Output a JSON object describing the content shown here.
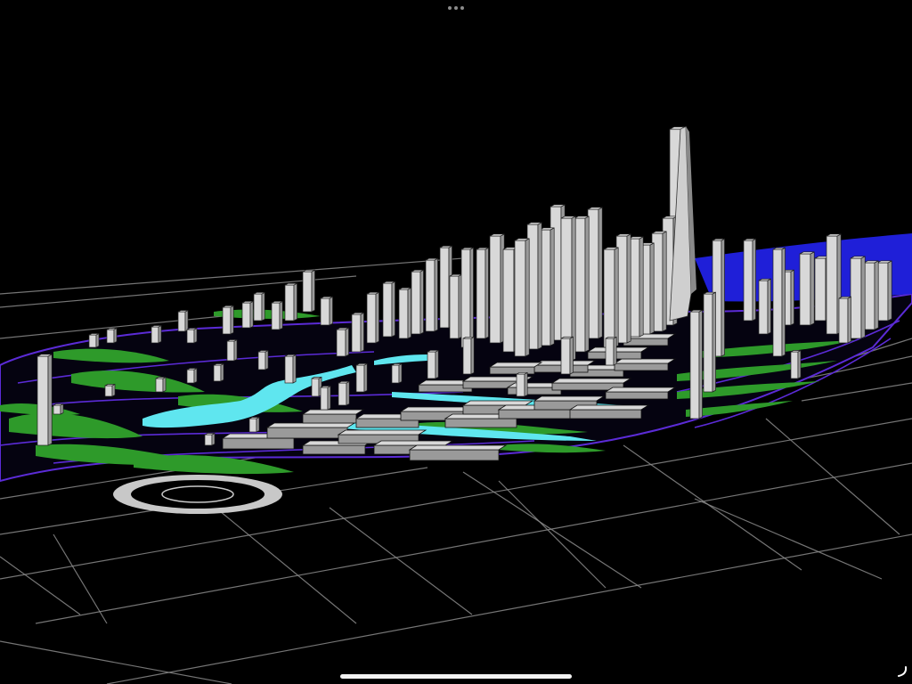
{
  "app": {
    "name": "",
    "view": "3D urban model"
  },
  "colors": {
    "background": "#000000",
    "road_lines": "#8a8a8a",
    "district_boundary": "#5b2bd6",
    "green_space": "#2e9a2a",
    "water": "#5fe6ef",
    "building_face_light": "#d8d8d8",
    "building_face_dark": "#9a9a9a",
    "distant_water": "#1f1fd8",
    "home_indicator": "#f2f2f2"
  },
  "icons": {
    "multitask": "ellipsis-dots-icon",
    "home": "home-indicator-bar",
    "corner": "corner-swipe-icon"
  }
}
